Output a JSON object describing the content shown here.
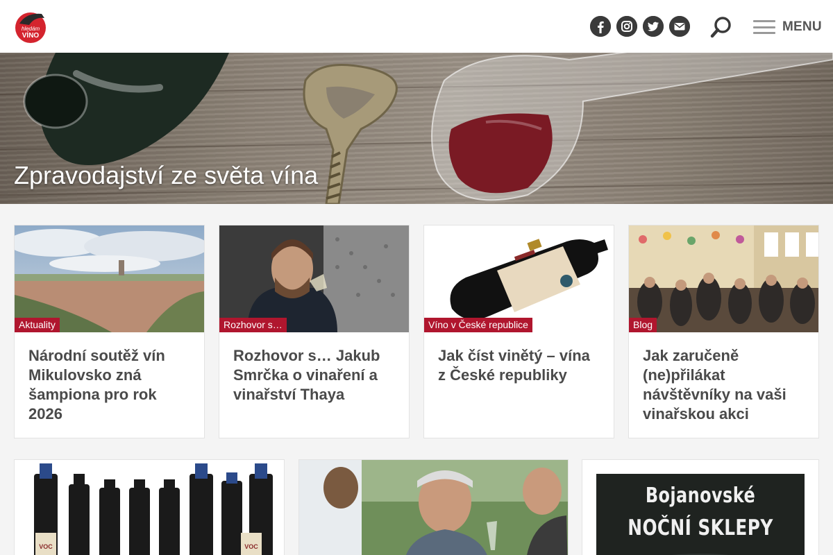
{
  "header": {
    "logo_text_top": "hledám",
    "logo_text_bottom": "VÍNO",
    "social": [
      {
        "name": "facebook-icon"
      },
      {
        "name": "instagram-icon"
      },
      {
        "name": "twitter-icon"
      },
      {
        "name": "mail-icon"
      }
    ],
    "menu_label": "MENU"
  },
  "hero": {
    "title": "Zpravodajství ze světa vína"
  },
  "cards": [
    {
      "tag": "Aktuality",
      "title": "Národní soutěž vín Mikulovsko zná šampiona pro rok 2026"
    },
    {
      "tag": "Rozhovor s…",
      "title": "Rozhovor s… Jakub Smrčka o vinaření a vinařství Thaya"
    },
    {
      "tag": "Víno v České republice",
      "title": "Jak číst vinětý – vína z České republiky"
    },
    {
      "tag": "Blog",
      "title": "Jak zaručeně (ne)přilákat návštěvníky na vaši vinařskou akci"
    }
  ],
  "banner": {
    "line1": "Bojanovské",
    "line2": "NOČNÍ SKLEPY"
  },
  "bottle_labels": [
    "VOC",
    "VOC"
  ],
  "colors": {
    "accent": "#b0162e",
    "icon_dark": "#3a3a3a",
    "title_text": "#4a4a4a"
  }
}
